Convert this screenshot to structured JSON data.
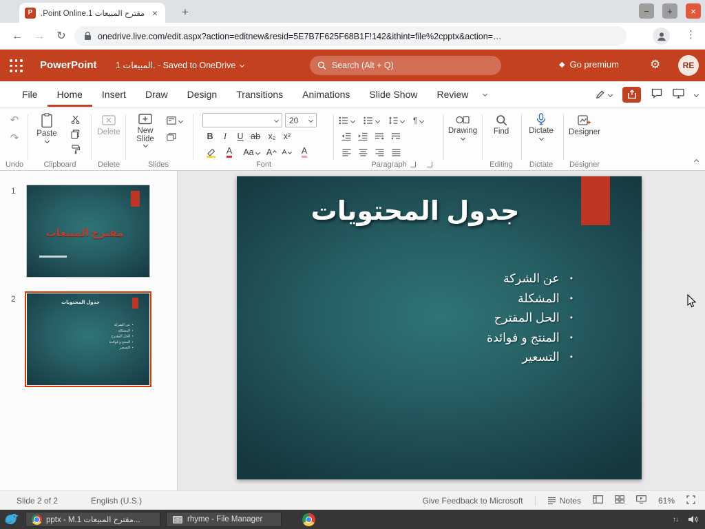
{
  "colors": {
    "brand": "#C3411E",
    "slide_red": "#BE3523",
    "slide_teal_center": "#2F7477",
    "slide_teal_edge": "#16393F"
  },
  "browser": {
    "tab_favicon": "P",
    "tab_title": ".Point Online.1 مقترح المبيعات",
    "tab_close": "×",
    "new_tab": "+",
    "url": "onedrive.live.com/edit.aspx?action=editnew&resid=5E7B7F625F68B1F!142&ithint=file%2cpptx&action=…",
    "window_controls": {
      "minimize": "−",
      "maximize": "+",
      "close": "×"
    },
    "nav": {
      "back": "←",
      "forward": "→",
      "reload": "↻",
      "menu": "⋮"
    }
  },
  "header": {
    "app_name": "PowerPoint",
    "doc_title": "المبيعات 1. - Saved to OneDrive",
    "search_placeholder": "Search (Alt + Q)",
    "premium_icon": "◆",
    "premium_label": "Go premium",
    "gear_icon": "⚙",
    "avatar_initials": "RE"
  },
  "menubar": {
    "items": [
      {
        "label": "File"
      },
      {
        "label": "Home"
      },
      {
        "label": "Insert"
      },
      {
        "label": "Draw"
      },
      {
        "label": "Design"
      },
      {
        "label": "Transitions"
      },
      {
        "label": "Animations"
      },
      {
        "label": "Slide Show"
      },
      {
        "label": "Review"
      }
    ],
    "active": "Home"
  },
  "ribbon": {
    "undo_icon": "↶",
    "redo_icon": "↷",
    "paste_label": "Paste",
    "delete_label": "Delete",
    "new_slide_label_1": "New",
    "new_slide_label_2": "Slide",
    "font_name_value": "",
    "font_size_value": "20",
    "bold": "B",
    "italic": "I",
    "underline": "U",
    "strikethrough": "ab",
    "subscript": "x₂",
    "superscript": "x²",
    "font_color": "A",
    "change_case": "Aa",
    "grow_font": "A",
    "shrink_font": "A",
    "clear_format": "A",
    "direction_icon": "¶",
    "drawing_label": "Drawing",
    "find_label": "Find",
    "dictate_label": "Dictate",
    "designer_label": "Designer",
    "group_labels": {
      "undo": "Undo",
      "clipboard": "Clipboard",
      "delete": "Delete",
      "slides": "Slides",
      "font": "Font",
      "paragraph": "Paragraph",
      "editing": "Editing",
      "dictate": "Dictate",
      "designer": "Designer"
    }
  },
  "slides_panel": {
    "slide1_number": "1",
    "slide2_number": "2",
    "slide1_title": "مقترح المبيعات"
  },
  "slide": {
    "title": "جدول المحتويات",
    "bullet_char": "•",
    "bullets": [
      "عن الشركة",
      "المشكلة",
      "الحل المقترح",
      "المنتج و فوائدة",
      "التسعير"
    ]
  },
  "statusbar": {
    "slide_info": "Slide 2 of 2",
    "language": "English (U.S.)",
    "feedback": "Give Feedback to Microsoft",
    "notes_label": "Notes",
    "zoom_level": "61%"
  },
  "taskbar": {
    "window1_title": "pptx - M.1 مقترح المبيعات...",
    "window2_title": "rhyme - File Manager",
    "tray_arrows": "↑↓"
  }
}
